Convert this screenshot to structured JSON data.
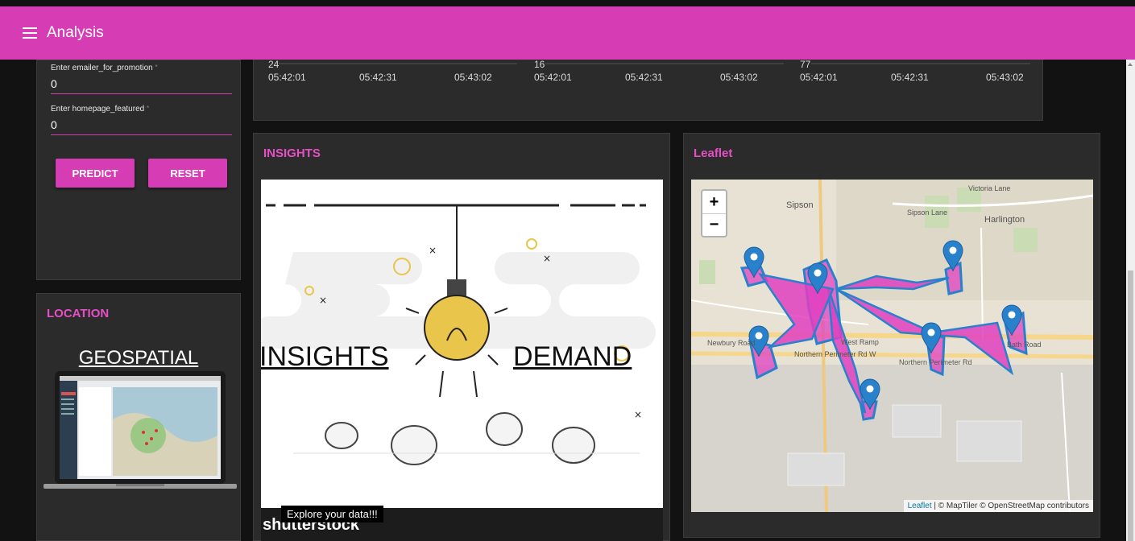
{
  "app": {
    "title": "Analysis"
  },
  "form": {
    "fields": [
      {
        "label": "Enter emailer_for_promotion",
        "value": "0"
      },
      {
        "label": "Enter homepage_featured",
        "value": "0"
      }
    ],
    "predict_label": "PREDICT",
    "reset_label": "RESET"
  },
  "charts": {
    "panels": [
      {
        "value": "24",
        "ticks": [
          "05:42:01",
          "05:42:31",
          "05:43:02"
        ]
      },
      {
        "value": "16",
        "ticks": [
          "05:42:01",
          "05:42:31",
          "05:43:02"
        ]
      },
      {
        "value": "77",
        "ticks": [
          "05:42:01",
          "05:42:31",
          "05:43:02"
        ]
      }
    ]
  },
  "location": {
    "title": "LOCATION",
    "heading": "GEOSPATIAL"
  },
  "insights": {
    "title": "INSIGHTS",
    "word_left": "INSIGHTS",
    "word_right": "DEMAND",
    "watermark": "shutterstock",
    "tooltip": "Explore your data!!!"
  },
  "leaflet": {
    "title": "Leaflet",
    "zoom_in": "+",
    "zoom_out": "−",
    "attribution_leaflet": "Leaflet",
    "attribution_rest": " | © MapTiler © OpenStreetMap contributors",
    "labels": [
      "Sipson",
      "Harlington",
      "Sipson Lane",
      "West Ramp",
      "Northern Perimeter Rd",
      "Newbury Road",
      "Bath Road",
      "Northern Perimeter Rd W",
      "Victoria Lane"
    ]
  },
  "colors": {
    "accent": "#d63db5",
    "title": "#e64fc5",
    "card": "#2b2b2b",
    "marker": "#2a81cb",
    "route": "#e040c0"
  }
}
